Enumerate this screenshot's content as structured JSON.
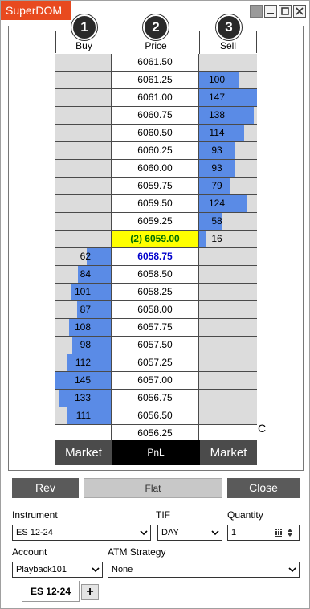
{
  "window": {
    "title": "SuperDOM"
  },
  "columns": {
    "buy": {
      "label": "Buy",
      "badge": "1"
    },
    "price": {
      "label": "Price",
      "badge": "2"
    },
    "sell": {
      "label": "Sell",
      "badge": "3"
    }
  },
  "ladder": [
    {
      "price": "6061.50",
      "buy": "",
      "sell": "",
      "sell_fill": 0,
      "buy_fill": 0
    },
    {
      "price": "6061.25",
      "buy": "",
      "sell": "100",
      "sell_fill": 0.68,
      "buy_fill": 0
    },
    {
      "price": "6061.00",
      "buy": "",
      "sell": "147",
      "sell_fill": 1.0,
      "buy_fill": 0
    },
    {
      "price": "6060.75",
      "buy": "",
      "sell": "138",
      "sell_fill": 0.94,
      "buy_fill": 0
    },
    {
      "price": "6060.50",
      "buy": "",
      "sell": "114",
      "sell_fill": 0.78,
      "buy_fill": 0
    },
    {
      "price": "6060.25",
      "buy": "",
      "sell": "93",
      "sell_fill": 0.63,
      "buy_fill": 0
    },
    {
      "price": "6060.00",
      "buy": "",
      "sell": "93",
      "sell_fill": 0.63,
      "buy_fill": 0
    },
    {
      "price": "6059.75",
      "buy": "",
      "sell": "79",
      "sell_fill": 0.54,
      "buy_fill": 0
    },
    {
      "price": "6059.50",
      "buy": "",
      "sell": "124",
      "sell_fill": 0.84,
      "buy_fill": 0
    },
    {
      "price": "6059.25",
      "buy": "",
      "sell": "58",
      "sell_fill": 0.39,
      "buy_fill": 0
    },
    {
      "price": "(2) 6059.00",
      "buy": "",
      "sell": "16",
      "sell_fill": 0.11,
      "buy_fill": 0,
      "state": "cur"
    },
    {
      "price": "6058.75",
      "buy": "62",
      "sell": "",
      "sell_fill": 0,
      "buy_fill": 0.43,
      "state": "bid"
    },
    {
      "price": "6058.50",
      "buy": "84",
      "sell": "",
      "sell_fill": 0,
      "buy_fill": 0.58,
      "state": ""
    },
    {
      "price": "6058.25",
      "buy": "101",
      "sell": "",
      "sell_fill": 0,
      "buy_fill": 0.7,
      "state": ""
    },
    {
      "price": "6058.00",
      "buy": "87",
      "sell": "",
      "sell_fill": 0,
      "buy_fill": 0.6,
      "state": ""
    },
    {
      "price": "6057.75",
      "buy": "108",
      "sell": "",
      "sell_fill": 0,
      "buy_fill": 0.74,
      "state": ""
    },
    {
      "price": "6057.50",
      "buy": "98",
      "sell": "",
      "sell_fill": 0,
      "buy_fill": 0.68,
      "state": ""
    },
    {
      "price": "6057.25",
      "buy": "112",
      "sell": "",
      "sell_fill": 0,
      "buy_fill": 0.77,
      "state": ""
    },
    {
      "price": "6057.00",
      "buy": "145",
      "sell": "",
      "sell_fill": 0,
      "buy_fill": 1.0,
      "state": ""
    },
    {
      "price": "6056.75",
      "buy": "133",
      "sell": "",
      "sell_fill": 0,
      "buy_fill": 0.92,
      "state": ""
    },
    {
      "price": "6056.50",
      "buy": "111",
      "sell": "",
      "sell_fill": 0,
      "buy_fill": 0.77,
      "state": ""
    },
    {
      "price": "6056.25",
      "buy": "",
      "sell": "",
      "sell_fill": 0,
      "buy_fill": 0,
      "state": "mid"
    }
  ],
  "bottom": {
    "market_buy": "Market",
    "pnl": "PnL",
    "market_sell": "Market",
    "c": "C"
  },
  "actions": {
    "rev": "Rev",
    "flat": "Flat",
    "close": "Close"
  },
  "form": {
    "instrument_label": "Instrument",
    "instrument_value": "ES 12-24",
    "tif_label": "TIF",
    "tif_value": "DAY",
    "quantity_label": "Quantity",
    "quantity_value": "1",
    "account_label": "Account",
    "account_value": "Playback101",
    "atm_label": "ATM Strategy",
    "atm_value": "None"
  },
  "tabs": {
    "active": "ES 12-24",
    "add": "+"
  },
  "colors": {
    "title_bg": "#e84a1f",
    "depth_bar": "#5a8be6",
    "current_price_bg": "#ffff00",
    "button_dark": "#5a5a5a"
  }
}
